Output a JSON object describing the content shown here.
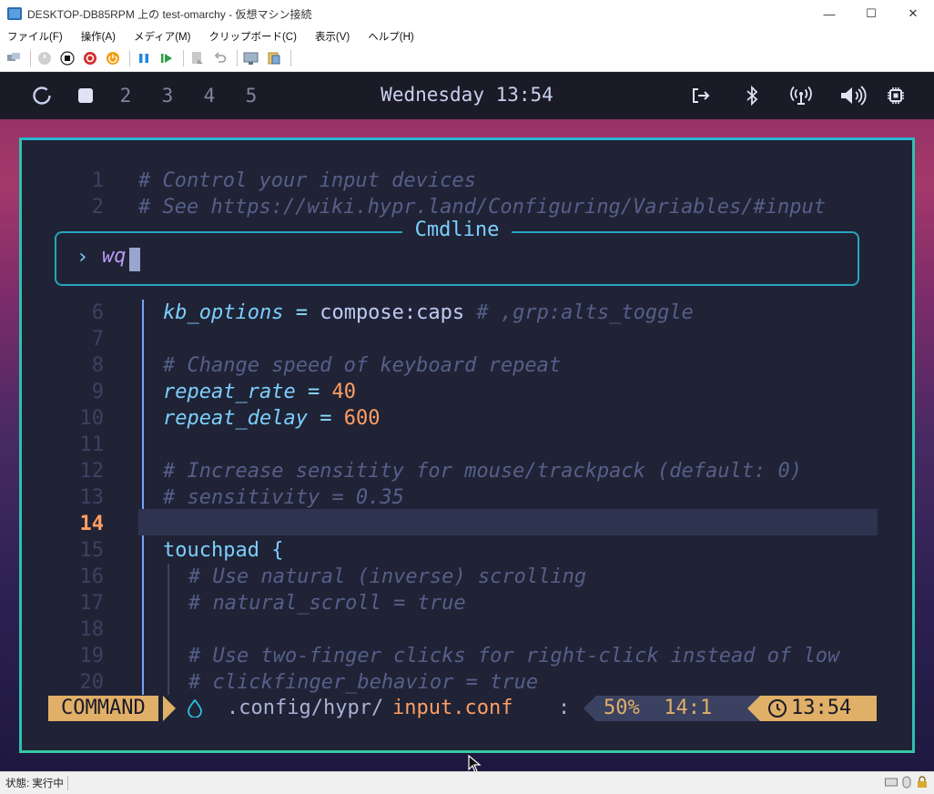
{
  "window": {
    "title": "DESKTOP-DB85RPM 上の test-omarchy  - 仮想マシン接続",
    "controls": [
      "—",
      "☐",
      "✕"
    ]
  },
  "menubar": {
    "items": [
      "ファイル(F)",
      "操作(A)",
      "メディア(M)",
      "クリップボード(C)",
      "表示(V)",
      "ヘルプ(H)"
    ]
  },
  "toolbar": {
    "icons": [
      "ctrl-alt-del-icon",
      "start-icon",
      "turn-off-icon",
      "shutdown-icon",
      "power-icon",
      "pause-icon",
      "resume-icon",
      "checkpoint-icon",
      "revert-icon",
      "enhanced-session-icon",
      "share-icon"
    ]
  },
  "waybar": {
    "workspaces": [
      "2",
      "3",
      "4",
      "5"
    ],
    "clock": "Wednesday 13:54",
    "icons": [
      "logout-icon",
      "bluetooth-icon",
      "wifi-icon",
      "volume-icon",
      "cpu-icon"
    ]
  },
  "editor": {
    "top_lines": [
      {
        "num": "1",
        "text": "# Control your input devices"
      },
      {
        "num": "2",
        "text": "# See https://wiki.hypr.land/Configuring/Variables/#input"
      }
    ],
    "cmdline": {
      "title": "Cmdline",
      "prompt": "›",
      "text": "wq"
    },
    "lines": [
      {
        "num": "6"
      },
      {
        "num": "7"
      },
      {
        "num": "8"
      },
      {
        "num": "9"
      },
      {
        "num": "10"
      },
      {
        "num": "11"
      },
      {
        "num": "12"
      },
      {
        "num": "13"
      },
      {
        "num": "14"
      },
      {
        "num": "15"
      },
      {
        "num": "16"
      },
      {
        "num": "17"
      },
      {
        "num": "18"
      },
      {
        "num": "19"
      },
      {
        "num": "20"
      }
    ],
    "code": {
      "l6_key": "kb_options",
      "l6_eq": " = ",
      "l6_val": "compose:caps ",
      "l6_comment": "# ,grp:alts_toggle",
      "l8": "# Change speed of keyboard repeat",
      "l9_key": "repeat_rate",
      "l9_eq": " = ",
      "l9_val": "40",
      "l10_key": "repeat_delay",
      "l10_eq": " = ",
      "l10_val": "600",
      "l12": "# Increase sensitity for mouse/trackpack (default: 0)",
      "l13": "# sensitivity = 0.35",
      "l15_key": "touchpad ",
      "l15_brace": "{",
      "l16": "# Use natural (inverse) scrolling",
      "l17": "# natural_scroll = true",
      "l19": "# Use two-finger clicks for right-click instead of low",
      "l20": "# clickfinger_behavior = true"
    },
    "statusline": {
      "mode": "COMMAND",
      "drop_icon": "water-drop-icon",
      "dir": ".config/hypr/",
      "file": "input.conf",
      "colon": ":",
      "percent": "50%",
      "position": "14:1",
      "time": "13:54"
    }
  },
  "host_status": {
    "text": "状態: 実行中"
  }
}
